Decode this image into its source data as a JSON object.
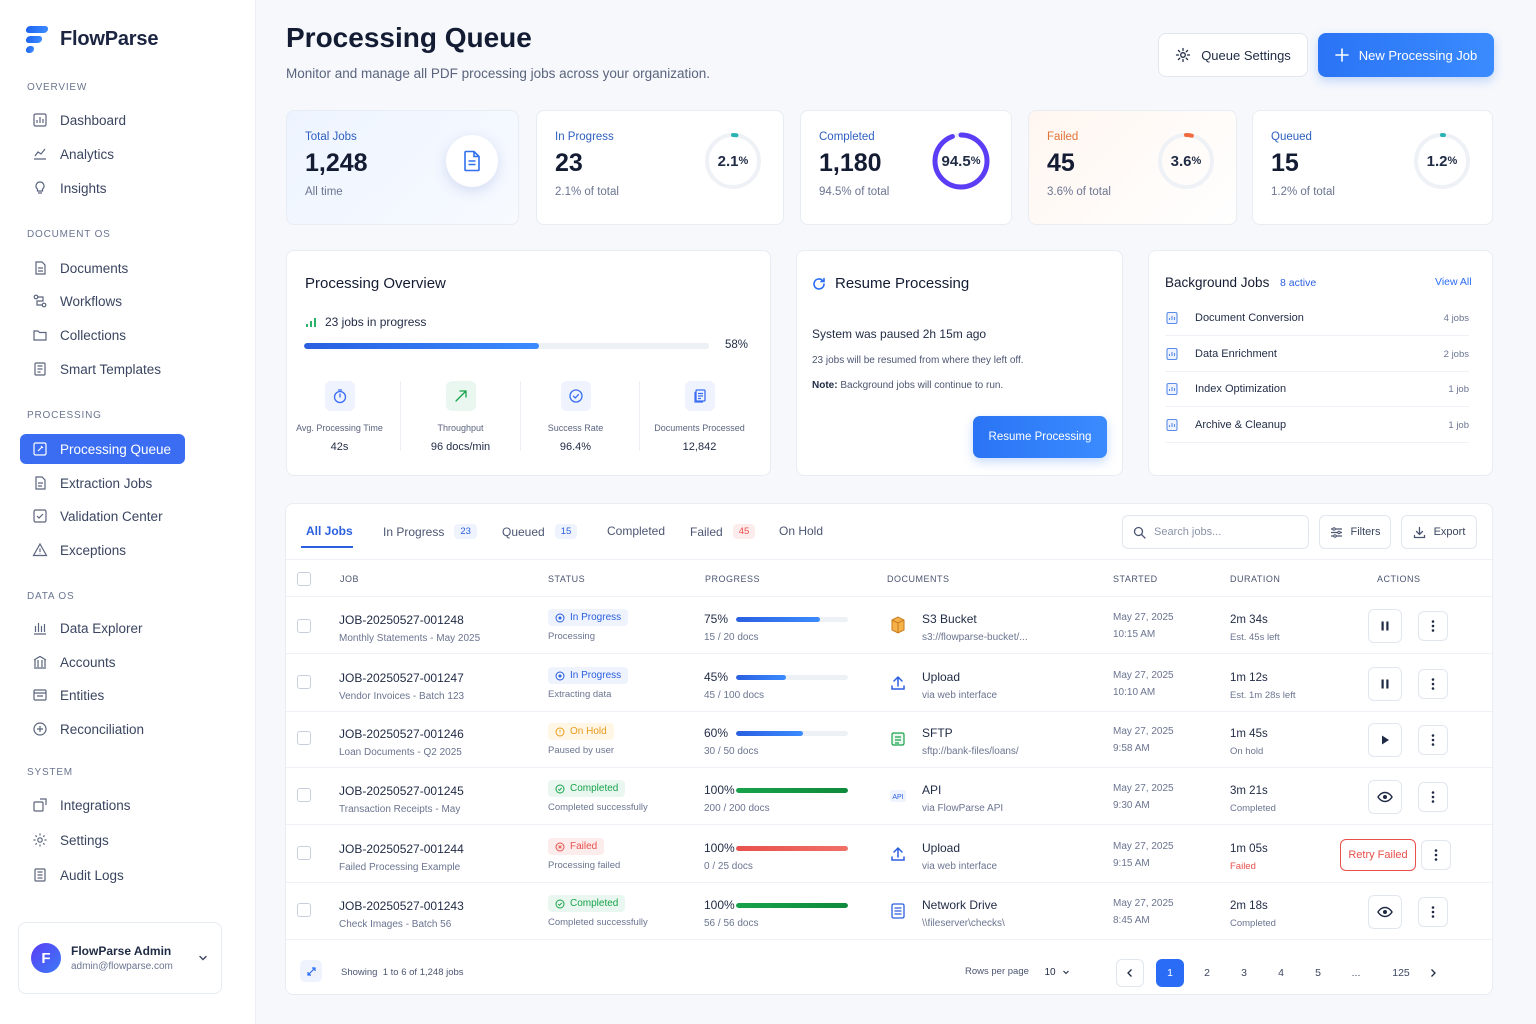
{
  "app": {
    "name": "FlowParse"
  },
  "nav": {
    "sections": [
      {
        "title": "OVERVIEW",
        "items": [
          "Dashboard",
          "Analytics",
          "Insights"
        ]
      },
      {
        "title": "DOCUMENT OS",
        "items": [
          "Documents",
          "Workflows",
          "Collections",
          "Smart Templates"
        ]
      },
      {
        "title": "PROCESSING",
        "items": [
          "Processing Queue",
          "Extraction Jobs",
          "Validation Center",
          "Exceptions"
        ]
      },
      {
        "title": "DATA OS",
        "items": [
          "Data Explorer",
          "Accounts",
          "Entities",
          "Reconciliation"
        ]
      },
      {
        "title": "SYSTEM",
        "items": [
          "Integrations",
          "Settings",
          "Audit Logs"
        ]
      }
    ],
    "active": "Processing Queue"
  },
  "user": {
    "initial": "F",
    "name": "FlowParse Admin",
    "email": "admin@flowparse.com"
  },
  "header": {
    "title": "Processing Queue",
    "subtitle": "Monitor and manage all PDF processing jobs across your organization.",
    "settings_label": "Queue Settings",
    "new_label": "New Processing Job"
  },
  "stats": [
    {
      "label": "Total Jobs",
      "value": "1,248",
      "sub": "All time",
      "color": "#2e5fbf"
    },
    {
      "label": "In Progress",
      "value": "23",
      "sub": "2.1% of total",
      "pct": "2.1",
      "fraction": 0.021,
      "color": "#2bb3b3"
    },
    {
      "label": "Completed",
      "value": "1,180",
      "sub": "94.5% of total",
      "pct": "94.5",
      "fraction": 0.945,
      "color": "#5b3df5"
    },
    {
      "label": "Failed",
      "value": "45",
      "sub": "3.6% of total",
      "pct": "3.6",
      "fraction": 0.036,
      "color": "#f06a3e"
    },
    {
      "label": "Queued",
      "value": "15",
      "sub": "1.2% of total",
      "pct": "1.2",
      "fraction": 0.012,
      "color": "#2bb3b3"
    }
  ],
  "overview": {
    "title": "Processing Overview",
    "jobs_in_progress": "23 jobs in progress",
    "progress_pct": "58%",
    "progress_fraction": 0.58,
    "metrics": [
      {
        "label": "Avg. Processing Time",
        "value": "42s"
      },
      {
        "label": "Throughput",
        "value": "96 docs/min"
      },
      {
        "label": "Success Rate",
        "value": "96.4%"
      },
      {
        "label": "Documents Processed",
        "value": "12,842"
      }
    ]
  },
  "resume": {
    "title": "Resume Processing",
    "paused": "System was paused 2h 15m ago",
    "info": "23 jobs will be resumed from where they left off.",
    "note_label": "Note:",
    "note": "Background jobs will continue to run.",
    "button": "Resume Processing"
  },
  "background": {
    "title": "Background Jobs",
    "active": "8 active",
    "view_all": "View All",
    "items": [
      {
        "name": "Document Conversion",
        "count": "4 jobs"
      },
      {
        "name": "Data Enrichment",
        "count": "2 jobs"
      },
      {
        "name": "Index Optimization",
        "count": "1 job"
      },
      {
        "name": "Archive & Cleanup",
        "count": "1 job"
      }
    ]
  },
  "tabs": [
    {
      "label": "All Jobs",
      "count": ""
    },
    {
      "label": "In Progress",
      "count": "23"
    },
    {
      "label": "Queued",
      "count": "15"
    },
    {
      "label": "Completed",
      "count": ""
    },
    {
      "label": "Failed",
      "count": "45"
    },
    {
      "label": "On Hold",
      "count": ""
    }
  ],
  "search": {
    "placeholder": "Search jobs..."
  },
  "toolbar": {
    "filters": "Filters",
    "export": "Export"
  },
  "columns": [
    "JOB",
    "STATUS",
    "PROGRESS",
    "DOCUMENTS",
    "STARTED",
    "DURATION",
    "ACTIONS"
  ],
  "jobs": [
    {
      "id": "JOB-20250527-001248",
      "desc": "Monthly Statements - May 2025",
      "status": "In Progress",
      "status_sub": "Processing",
      "progress": "75%",
      "fraction": 0.75,
      "docs": "15 / 20 docs",
      "source": "S3 Bucket",
      "source_sub": "s3://flowparse-bucket/...",
      "date": "May 27, 2025",
      "time": "10:15 AM",
      "duration": "2m 34s",
      "duration_sub": "Est. 45s left",
      "action": "pause"
    },
    {
      "id": "JOB-20250527-001247",
      "desc": "Vendor Invoices - Batch 123",
      "status": "In Progress",
      "status_sub": "Extracting data",
      "progress": "45%",
      "fraction": 0.45,
      "docs": "45 / 100 docs",
      "source": "Upload",
      "source_sub": "via web interface",
      "date": "May 27, 2025",
      "time": "10:10 AM",
      "duration": "1m 12s",
      "duration_sub": "Est. 1m 28s left",
      "action": "pause"
    },
    {
      "id": "JOB-20250527-001246",
      "desc": "Loan Documents - Q2 2025",
      "status": "On Hold",
      "status_sub": "Paused by user",
      "progress": "60%",
      "fraction": 0.6,
      "docs": "30 / 50 docs",
      "source": "SFTP",
      "source_sub": "sftp://bank-files/loans/",
      "date": "May 27, 2025",
      "time": "9:58 AM",
      "duration": "1m 45s",
      "duration_sub": "On hold",
      "action": "play"
    },
    {
      "id": "JOB-20250527-001245",
      "desc": "Transaction Receipts - May",
      "status": "Completed",
      "status_sub": "Completed successfully",
      "progress": "100%",
      "fraction": 1.0,
      "docs": "200 / 200 docs",
      "source": "API",
      "source_sub": "via FlowParse API",
      "date": "May 27, 2025",
      "time": "9:30 AM",
      "duration": "3m 21s",
      "duration_sub": "Completed",
      "action": "view"
    },
    {
      "id": "JOB-20250527-001244",
      "desc": "Failed Processing Example",
      "status": "Failed",
      "status_sub": "Processing failed",
      "progress": "100%",
      "fraction": 1.0,
      "docs": "0 / 25 docs",
      "source": "Upload",
      "source_sub": "via web interface",
      "date": "May 27, 2025",
      "time": "9:15 AM",
      "duration": "1m 05s",
      "duration_sub": "Failed",
      "action": "Retry Failed"
    },
    {
      "id": "JOB-20250527-001243",
      "desc": "Check Images - Batch 56",
      "status": "Completed",
      "status_sub": "Completed successfully",
      "progress": "100%",
      "fraction": 1.0,
      "docs": "56 / 56 docs",
      "source": "Network Drive",
      "source_sub": "\\\\fileserver\\checks\\",
      "date": "May 27, 2025",
      "time": "8:45 AM",
      "duration": "2m 18s",
      "duration_sub": "Completed",
      "action": "view"
    }
  ],
  "pagination": {
    "showing_label": "Showing",
    "showing": "1 to 6 of 1,248 jobs",
    "rows_label": "Rows per page",
    "rows_value": "10",
    "pages": [
      "1",
      "2",
      "3",
      "4",
      "5",
      "...",
      "125"
    ],
    "current": "1"
  },
  "colors": {
    "accent": "#2a6cf5",
    "success": "#17a34a",
    "warning": "#f0a020",
    "danger": "#e8504c"
  }
}
